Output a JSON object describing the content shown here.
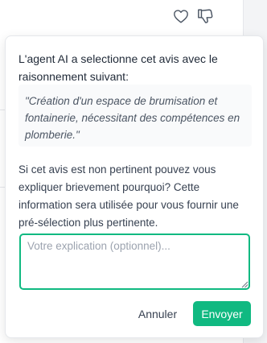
{
  "feedback": {
    "like_icon": "heart-icon",
    "dislike_icon": "thumbs-down-icon"
  },
  "popover": {
    "title": "L'agent AI a selectionne cet avis avec le raisonnement suivant:",
    "reasoning_quote": "\"Création d'un espace de brumisation et fontainerie, nécessitant des compétences en plomberie.\"",
    "explanation_prompt": "Si cet avis est non pertinent pouvez vous expliquer brievement pourquoi? Cette information sera utilisée pour vous fournir une pré-sélection plus pertinente.",
    "textarea": {
      "value": "",
      "placeholder": "Votre explication (optionnel)..."
    },
    "cancel_label": "Annuler",
    "send_label": "Envoyer"
  },
  "colors": {
    "accent": "#10b981",
    "quote_bg": "#f9fafb",
    "text": "#1f2937"
  }
}
